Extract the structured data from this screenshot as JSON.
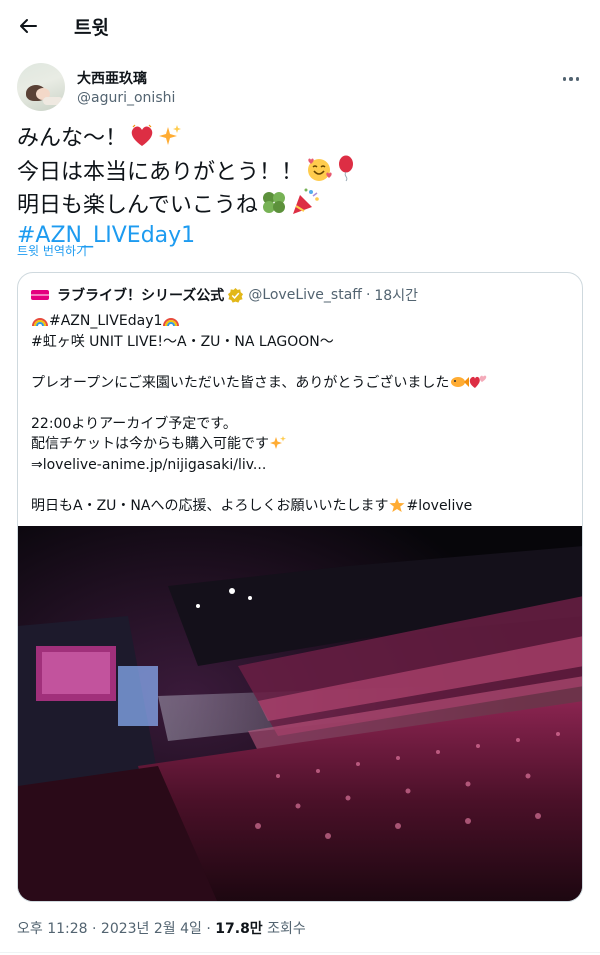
{
  "header": {
    "title": "트윗",
    "back_icon": "arrow-left-icon"
  },
  "author": {
    "name": "大西亜玖璃",
    "handle": "@aguri_onishi"
  },
  "tweet": {
    "line1": "みんな〜！",
    "line2": "今日は本当にありがとう！！",
    "line3": "明日も楽しんでいこうね",
    "hashtag": "#AZN_LIVEday1",
    "translate": "트윗 번역하기",
    "emojis": [
      "heart-icon",
      "sparkles-icon",
      "smiling-face-hearts-icon",
      "balloon-icon",
      "four-leaf-clover-icon",
      "party-popper-icon"
    ]
  },
  "quote": {
    "name": "ラブライブ！シリーズ公式",
    "handle": "@LoveLive_staff",
    "separator": "·",
    "time": "18시간",
    "lines": {
      "hashtag": "#AZN_LIVEday1",
      "event": "#虹ヶ咲 UNIT LIVE!〜A・ZU・NA LAGOON〜",
      "thanks": "プレオープンにご来園いただいた皆さま、ありがとうございました",
      "archive": "22:00よりアーカイブ予定です。",
      "ticket": "配信チケットは今からも購入可能です",
      "link": "⇒lovelive-anime.jp/nijigasaki/liv...",
      "support": "明日もA・ZU・NAへの応援、よろしくお願いいたします",
      "tag2": "#lovelive"
    },
    "image_alt": "concert-venue-photo"
  },
  "meta": {
    "time": "오후 11:28",
    "sep1": " · ",
    "date": "2023년 2월 4일",
    "sep2": " · ",
    "views": "17.8만",
    "views_label": " 조회수"
  },
  "colors": {
    "accent": "#1d9bf0",
    "text": "#0f1419",
    "secondary": "#536471",
    "border": "#cfd9de"
  }
}
